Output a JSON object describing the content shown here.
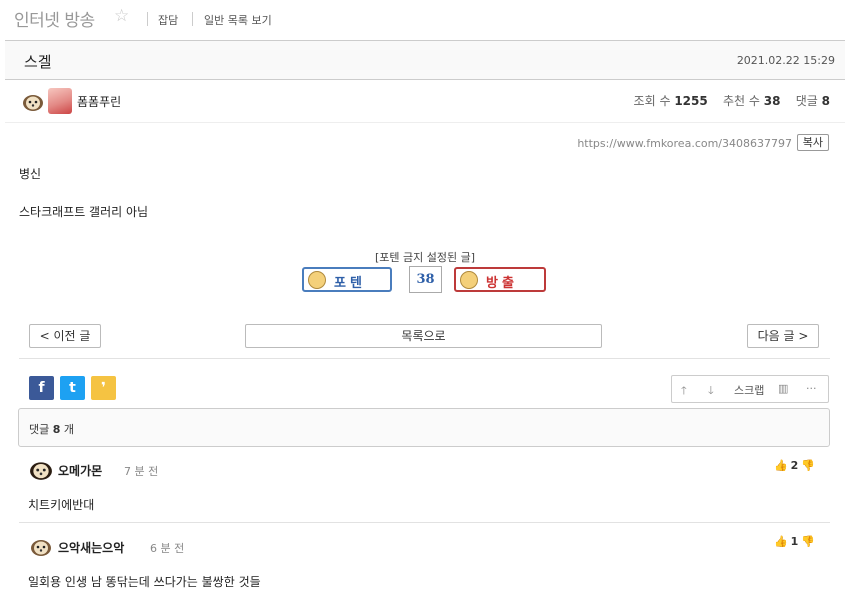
{
  "board": {
    "title": "인터넷 방송",
    "star": "☆",
    "links": [
      "잡담",
      "일반 목록 보기"
    ]
  },
  "post": {
    "title": "스겔",
    "date": "2021.02.22 15:29",
    "author": "폼폼푸린",
    "stats": {
      "views_label": "조회 수",
      "views": "1255",
      "recommend_label": "추천 수",
      "recommend": "38",
      "comments_label": "댓글",
      "comments": "8"
    },
    "url": "https://www.fmkorea.com/3408637797",
    "copy_label": "복사",
    "body": [
      "병신",
      "스타크래프트 갤러리 아님"
    ]
  },
  "vote": {
    "note": "[포텐 금지 설정된 글]",
    "up_label": "포텐",
    "count": "38",
    "down_label": "방출"
  },
  "nav": {
    "prev": "< 이전 글",
    "list": "목록으로",
    "next": "다음 글 >"
  },
  "share": {
    "facebook": "f",
    "twitter": "t",
    "kakao": "❜"
  },
  "tools": {
    "up": "🡑",
    "down": "🡓",
    "scrap": "스크랩",
    "chart": "▥",
    "more": "···"
  },
  "comments_header": {
    "prefix": "댓글",
    "count": "8",
    "suffix": "개"
  },
  "comments": [
    {
      "author": "오메가몬",
      "time": "7 분 전",
      "text": "치트키에반대",
      "likes": "2",
      "up_icon": "👍",
      "down_icon": "👎"
    },
    {
      "author": "으악새는으악",
      "time": "6 분 전",
      "text": "일회용 인생 남 똥닦는데 쓰다가는 불쌍한 것들",
      "likes": "1",
      "up_icon": "👍",
      "down_icon": "👎"
    }
  ],
  "colors": {
    "facebook": "#3b5998",
    "twitter": "#1da1f2",
    "kakao": "#f5c342",
    "vote_up": "#4a7dbd",
    "vote_down": "#bd3a3a"
  }
}
